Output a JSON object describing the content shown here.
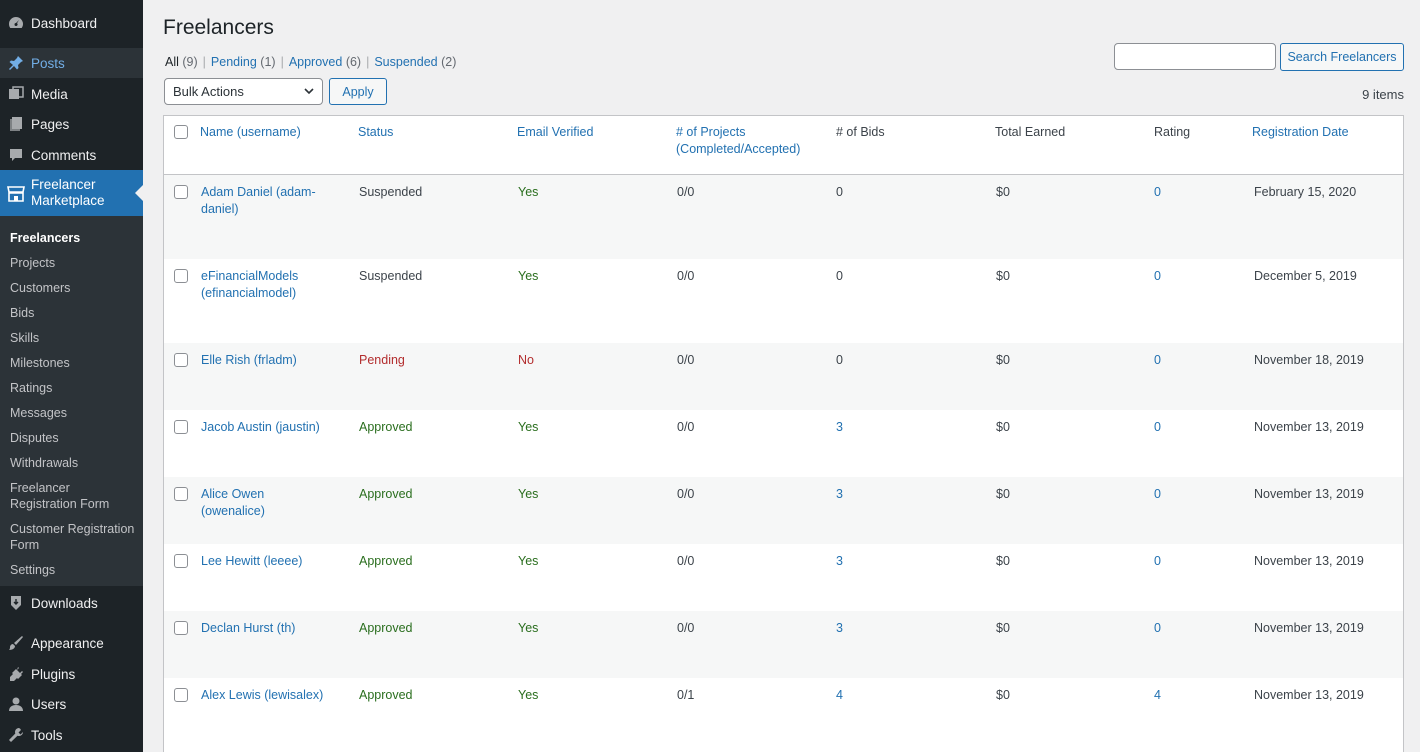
{
  "sidebar": {
    "items_top": [
      {
        "label": "Dashboard",
        "icon": "dashboard-icon"
      },
      {
        "label": "Posts",
        "icon": "pin-icon"
      },
      {
        "label": "Media",
        "icon": "media-icon"
      },
      {
        "label": "Pages",
        "icon": "pages-icon"
      },
      {
        "label": "Comments",
        "icon": "comments-icon"
      }
    ],
    "current": {
      "label": "Freelancer Marketplace",
      "icon": "store-icon"
    },
    "submenu": [
      "Freelancers",
      "Projects",
      "Customers",
      "Bids",
      "Skills",
      "Milestones",
      "Ratings",
      "Messages",
      "Disputes",
      "Withdrawals",
      "Freelancer Registration Form",
      "Customer Registration Form",
      "Settings"
    ],
    "items_bottom": [
      {
        "label": "Downloads",
        "icon": "downloads-icon"
      },
      {
        "label": "Appearance",
        "icon": "appearance-icon"
      },
      {
        "label": "Plugins",
        "icon": "plugins-icon"
      },
      {
        "label": "Users",
        "icon": "users-icon"
      },
      {
        "label": "Tools",
        "icon": "tools-icon"
      }
    ]
  },
  "page": {
    "title": "Freelancers",
    "filters": [
      {
        "label": "All",
        "count": "(9)"
      },
      {
        "label": "Pending",
        "count": "(1)"
      },
      {
        "label": "Approved",
        "count": "(6)"
      },
      {
        "label": "Suspended",
        "count": "(2)"
      }
    ],
    "search_button": "Search Freelancers",
    "bulk_actions": "Bulk Actions",
    "apply": "Apply",
    "items_count": "9 items"
  },
  "table": {
    "headers": [
      "Name (username)",
      "Status",
      "Email Verified",
      "# of Projects (Completed/Accepted)",
      "# of Bids",
      "Total Earned",
      "Rating",
      "Registration Date"
    ],
    "rows": [
      {
        "name": "Adam Daniel (adam-daniel)",
        "status": "Suspended",
        "email": "Yes",
        "projects": "0/0",
        "bids": "0",
        "earned": "$0",
        "rating": "0",
        "date": "February 15, 2020"
      },
      {
        "name": "eFinancialModels (efinancialmodel)",
        "status": "Suspended",
        "email": "Yes",
        "projects": "0/0",
        "bids": "0",
        "earned": "$0",
        "rating": "0",
        "date": "December 5, 2019"
      },
      {
        "name": "Elle Rish (frladm)",
        "status": "Pending",
        "email": "No",
        "projects": "0/0",
        "bids": "0",
        "earned": "$0",
        "rating": "0",
        "date": "November 18, 2019"
      },
      {
        "name": "Jacob Austin (jaustin)",
        "status": "Approved",
        "email": "Yes",
        "projects": "0/0",
        "bids": "3",
        "earned": "$0",
        "rating": "0",
        "date": "November 13, 2019"
      },
      {
        "name": "Alice Owen (owenalice)",
        "status": "Approved",
        "email": "Yes",
        "projects": "0/0",
        "bids": "3",
        "earned": "$0",
        "rating": "0",
        "date": "November 13, 2019"
      },
      {
        "name": "Lee Hewitt (leeee)",
        "status": "Approved",
        "email": "Yes",
        "projects": "0/0",
        "bids": "3",
        "earned": "$0",
        "rating": "0",
        "date": "November 13, 2019"
      },
      {
        "name": "Declan Hurst (th)",
        "status": "Approved",
        "email": "Yes",
        "projects": "0/0",
        "bids": "3",
        "earned": "$0",
        "rating": "0",
        "date": "November 13, 2019"
      },
      {
        "name": "Alex Lewis (lewisalex)",
        "status": "Approved",
        "email": "Yes",
        "projects": "0/1",
        "bids": "4",
        "earned": "$0",
        "rating": "4",
        "date": "November 13, 2019"
      }
    ]
  },
  "colors": {
    "sidebar_bg": "#1d2327",
    "accent": "#2271b1",
    "approved": "#2a6e1e",
    "pending": "#b32d2e"
  }
}
